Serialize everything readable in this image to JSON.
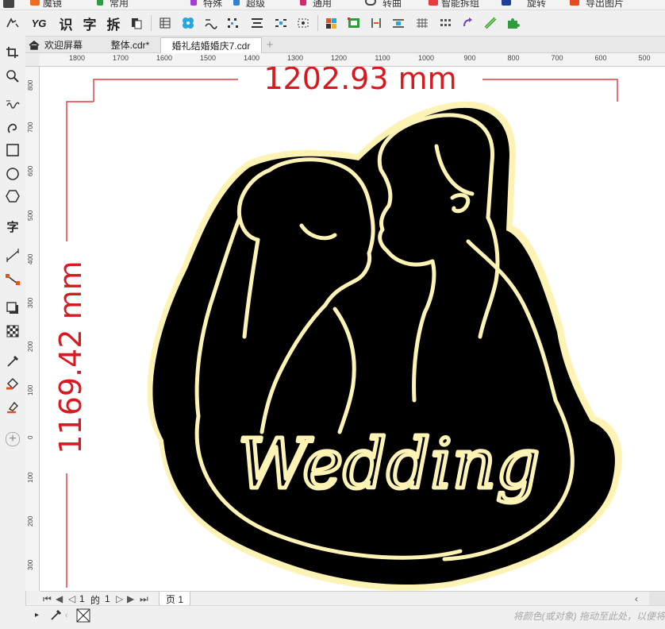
{
  "menu": {
    "items": [
      "魔镜",
      "常用",
      "特殊",
      "超级",
      "通用",
      "转曲",
      "智能拆组",
      "旋转",
      "导出图片"
    ]
  },
  "toolbar": {
    "yg_label": "YG",
    "recognize_label": "识",
    "text_label": "字",
    "split_label": "拆"
  },
  "toolbox": {
    "text_tool_label": "字",
    "add_label": "+"
  },
  "tabs": {
    "home": "欢迎屏幕",
    "tab1": "整体.cdr*",
    "tab2": "婚礼结婚婚庆7.cdr",
    "add": "+"
  },
  "ruler": {
    "h_labels": [
      "1800",
      "1700",
      "1600",
      "1500",
      "1400",
      "1300",
      "1200",
      "1100",
      "1000",
      "900",
      "800",
      "700",
      "600",
      "500"
    ],
    "v_labels": [
      "800",
      "700",
      "600",
      "500",
      "400",
      "300",
      "200",
      "100",
      "0",
      "100",
      "200",
      "300"
    ]
  },
  "canvas": {
    "width_dimension": "1202.93 mm",
    "height_dimension": "1169.42 mm",
    "artwork_text": "Wedding"
  },
  "pager": {
    "current": "1",
    "of_label": "的",
    "total": "1",
    "page_tab": "页 1"
  },
  "hint": "将颜色(或对象) 拖动至此处，以便将",
  "colors": {
    "dimension_red": "#d71920",
    "outline_cream": "#fdf3b5",
    "silhouette_black": "#000000"
  }
}
